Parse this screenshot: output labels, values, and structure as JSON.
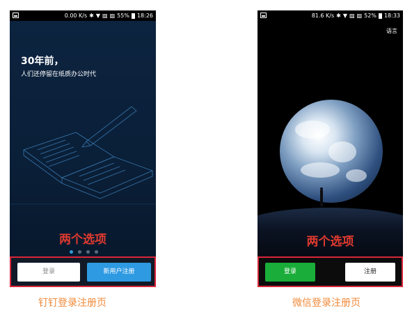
{
  "dingtalk": {
    "status": {
      "speed": "0.00 K/s",
      "battery": "55%",
      "time": "18:26",
      "bluetooth_icon": "bluetooth-icon",
      "wifi_icon": "wifi-icon"
    },
    "title": "30年前，",
    "subtitle": "人们还停留在纸质办公时代",
    "overlay_caption": "两个选项",
    "pager": {
      "count": 4,
      "active": 0
    },
    "login_button": "登录",
    "register_button": "新用户注册",
    "page_caption": "钉钉登录注册页"
  },
  "wechat": {
    "status": {
      "speed": "81.6 K/s",
      "battery": "52%",
      "time": "18:33"
    },
    "language_link": "语言",
    "overlay_caption": "两个选项",
    "login_button": "登录",
    "register_button": "注册",
    "page_caption": "微信登录注册页"
  },
  "colors": {
    "highlight_border": "#d9263a",
    "caption_red": "#e03a2f",
    "caption_orange": "#f08a3a",
    "dingtalk_blue": "#2e9ae2",
    "wechat_green": "#1aad39"
  }
}
